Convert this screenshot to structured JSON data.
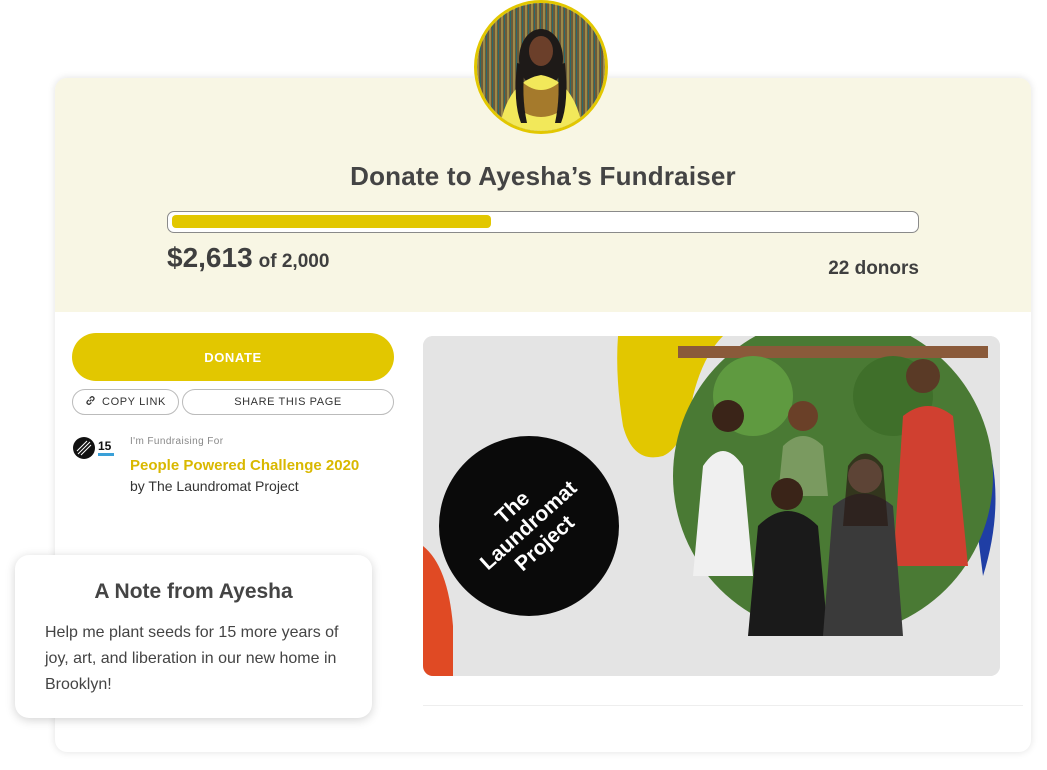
{
  "header": {
    "title": "Donate to Ayesha’s Fundraiser",
    "raised_amount": "$2,613",
    "goal_text": "of 2,000",
    "donors_text": "22 donors",
    "progress_fraction": 0.43
  },
  "actions": {
    "donate_label": "DONATE",
    "copy_link_label": "COPY LINK",
    "share_label": "SHARE THIS PAGE"
  },
  "organization": {
    "label": "I'm Fundraising For",
    "campaign_name": "People Powered Challenge 2020",
    "by_text": "by The Laundromat Project",
    "logo_number": "15"
  },
  "banner": {
    "logo_text_line1": "The",
    "logo_text_line2": "Laundromat",
    "logo_text_line3": "Project"
  },
  "note": {
    "title": "A Note from Ayesha",
    "body": "Help me plant seeds for 15 more years of joy, art, and liberation in our new home in Brooklyn!"
  },
  "colors": {
    "accent": "#e2c700",
    "header_bg": "#f8f6e4",
    "text_dark": "#3f3f3f"
  }
}
